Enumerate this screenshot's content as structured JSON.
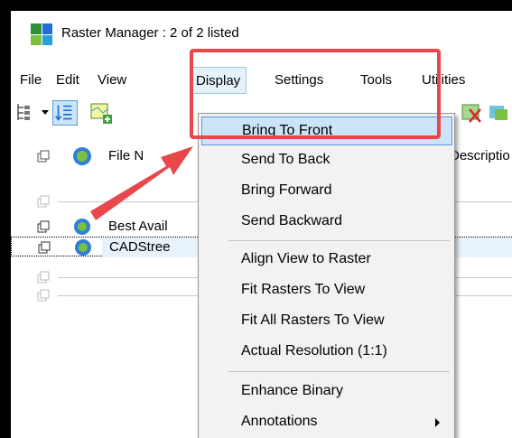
{
  "window": {
    "title": "Raster Manager : 2 of 2 listed"
  },
  "menubar": {
    "items": [
      "File",
      "Edit",
      "View",
      "Display",
      "Settings",
      "Tools",
      "Utilities"
    ]
  },
  "list": {
    "header": {
      "file_name": "File N",
      "description": "Descriptio"
    },
    "rows": [
      {
        "text": "",
        "selected": false
      },
      {
        "text": "Best Avail",
        "selected": false
      },
      {
        "text": "CADStree",
        "selected": true
      },
      {
        "text": "",
        "selected": false
      },
      {
        "text": "",
        "selected": false
      }
    ]
  },
  "display_menu": {
    "items": [
      {
        "label": "Bring To Front",
        "highlighted": true
      },
      {
        "label": "Send To Back"
      },
      {
        "label": "Bring Forward"
      },
      {
        "label": "Send Backward"
      },
      {
        "label": "Align View to Raster"
      },
      {
        "label": "Fit Rasters To View"
      },
      {
        "label": "Fit All Rasters To View"
      },
      {
        "label": "Actual Resolution (1:1)"
      },
      {
        "label": "Enhance Binary"
      },
      {
        "label": "Annotations",
        "has_submenu": true
      }
    ]
  },
  "colors": {
    "highlight": "#cce4f7",
    "callout": "#e8474c"
  }
}
